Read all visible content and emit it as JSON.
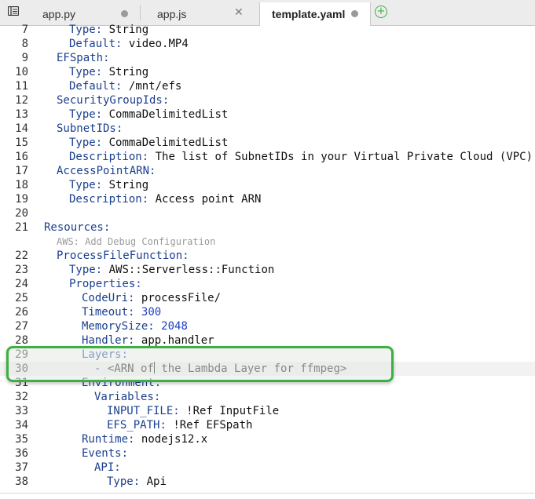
{
  "tabs": [
    {
      "label": "app.py",
      "state": "unsaved"
    },
    {
      "label": "app.js",
      "state": "closable"
    },
    {
      "label": "template.yaml",
      "state": "active-unsaved"
    }
  ],
  "lines": [
    {
      "n": "7",
      "indent": 2,
      "key": "Type",
      "value": "String"
    },
    {
      "n": "8",
      "indent": 2,
      "key": "Default",
      "value": "video.MP4"
    },
    {
      "n": "9",
      "indent": 1,
      "key": "EFSpath",
      "value": ""
    },
    {
      "n": "10",
      "indent": 2,
      "key": "Type",
      "value": "String"
    },
    {
      "n": "11",
      "indent": 2,
      "key": "Default",
      "value": "/mnt/efs"
    },
    {
      "n": "12",
      "indent": 1,
      "key": "SecurityGroupIds",
      "value": ""
    },
    {
      "n": "13",
      "indent": 2,
      "key": "Type",
      "value": "CommaDelimitedList"
    },
    {
      "n": "14",
      "indent": 1,
      "key": "SubnetIDs",
      "value": ""
    },
    {
      "n": "15",
      "indent": 2,
      "key": "Type",
      "value": "CommaDelimitedList"
    },
    {
      "n": "16",
      "indent": 2,
      "key": "Description",
      "value": "The list of SubnetIDs in your Virtual Private Cloud (VPC)"
    },
    {
      "n": "17",
      "indent": 1,
      "key": "AccessPointARN",
      "value": ""
    },
    {
      "n": "18",
      "indent": 2,
      "key": "Type",
      "value": "String"
    },
    {
      "n": "19",
      "indent": 2,
      "key": "Description",
      "value": "Access point ARN"
    },
    {
      "n": "20",
      "indent": 0,
      "key": "",
      "value": ""
    },
    {
      "n": "21",
      "indent": 0,
      "key": "Resources",
      "value": ""
    },
    {
      "n": "",
      "codelens": "AWS: Add Debug Configuration"
    },
    {
      "n": "22",
      "indent": 1,
      "key": "ProcessFileFunction",
      "value": ""
    },
    {
      "n": "23",
      "indent": 2,
      "key": "Type",
      "value": "AWS::Serverless::Function"
    },
    {
      "n": "24",
      "indent": 2,
      "key": "Properties",
      "value": ""
    },
    {
      "n": "25",
      "indent": 3,
      "key": "CodeUri",
      "value": "processFile/"
    },
    {
      "n": "26",
      "indent": 3,
      "key": "Timeout",
      "value": "300",
      "numeric": true
    },
    {
      "n": "27",
      "indent": 3,
      "key": "MemorySize",
      "value": "2048",
      "numeric": true
    },
    {
      "n": "28",
      "indent": 3,
      "key": "Handler",
      "value": "app.handler"
    },
    {
      "n": "29",
      "indent": 3,
      "key": "Layers",
      "value": ""
    },
    {
      "n": "30",
      "indent": 4,
      "dash": true,
      "before": "<ARN of",
      "after": " the Lambda Layer for ffmpeg>",
      "cursor": true
    },
    {
      "n": "31",
      "indent": 3,
      "key": "Environment",
      "value": ""
    },
    {
      "n": "32",
      "indent": 4,
      "key": "Variables",
      "value": ""
    },
    {
      "n": "33",
      "indent": 5,
      "key": "INPUT_FILE",
      "value": "!Ref InputFile"
    },
    {
      "n": "34",
      "indent": 5,
      "key": "EFS_PATH",
      "value": "!Ref EFSpath"
    },
    {
      "n": "35",
      "indent": 3,
      "key": "Runtime",
      "value": "nodejs12.x"
    },
    {
      "n": "36",
      "indent": 3,
      "key": "Events",
      "value": ""
    },
    {
      "n": "37",
      "indent": 4,
      "key": "API",
      "value": ""
    },
    {
      "n": "38",
      "indent": 5,
      "key": "Type",
      "value": "Api"
    }
  ]
}
